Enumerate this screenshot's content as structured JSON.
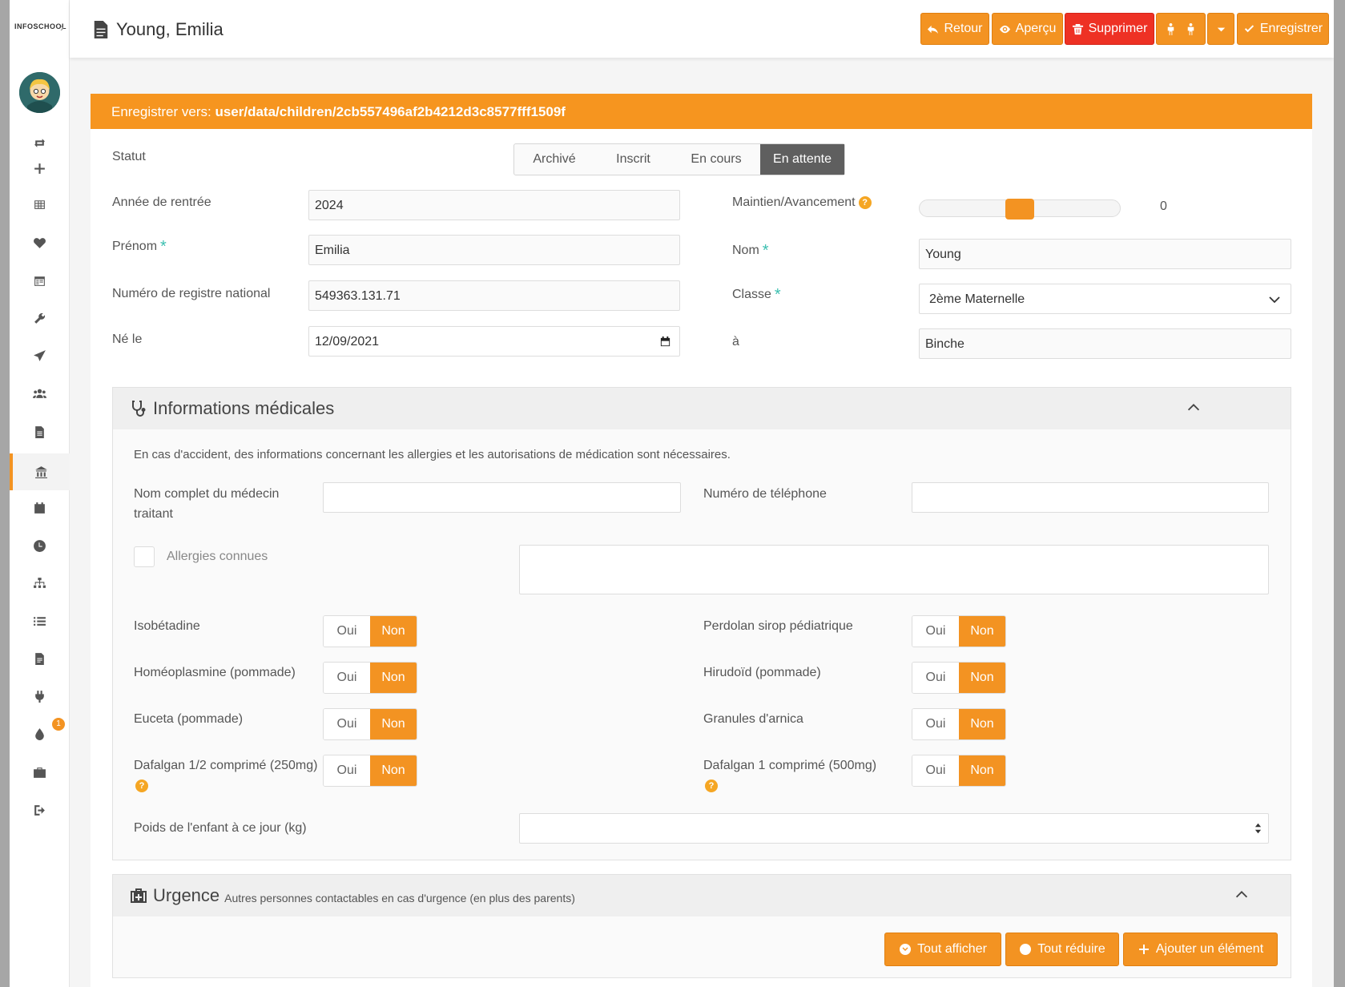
{
  "app": {
    "logo_text": "INFOSCHOOL"
  },
  "sidebar": {
    "badge_count": "1"
  },
  "header": {
    "title": "Young, Emilia",
    "buttons": {
      "back": "Retour",
      "preview": "Aperçu",
      "delete": "Supprimer",
      "save": "Enregistrer"
    }
  },
  "banner": {
    "prefix": "Enregistrer vers:",
    "path": "user/data/children/2cb557496af2b4212d3c8577fff1509f"
  },
  "form": {
    "status_label": "Statut",
    "status_options": [
      "Archivé",
      "Inscrit",
      "En cours",
      "En attente"
    ],
    "status_selected": "En attente",
    "entry_year_label": "Année de rentrée",
    "entry_year": "2024",
    "maintien_label": "Maintien/Avancement",
    "maintien_value": "0",
    "firstname_label": "Prénom",
    "firstname": "Emilia",
    "lastname_label": "Nom",
    "lastname": "Young",
    "national_id_label": "Numéro de registre national",
    "national_id": "549363.131.71",
    "class_label": "Classe",
    "class_value": "2ème Maternelle",
    "birth_label": "Né le",
    "birth_date": "12/09/2021",
    "birthplace_label": "à",
    "birthplace": "Binche"
  },
  "medical": {
    "title": "Informations médicales",
    "intro": "En cas d'accident, des informations concernant les allergies et les autorisations de médication sont nécessaires.",
    "doctor_label": "Nom complet du médecin traitant",
    "phone_label": "Numéro de téléphone",
    "allergies_label": "Allergies connues",
    "yes": "Oui",
    "no": "Non",
    "meds_left": [
      "Isobétadine",
      "Homéoplasmine (pommade)",
      "Euceta (pommade)",
      "Dafalgan 1/2 comprimé (250mg)"
    ],
    "meds_right": [
      "Perdolan sirop pédiatrique",
      "Hirudoïd (pommade)",
      "Granules d'arnica",
      "Dafalgan 1 comprimé (500mg)"
    ],
    "weight_label": "Poids de l'enfant à ce jour (kg)"
  },
  "urgence": {
    "title": "Urgence",
    "subtitle": "Autres personnes contactables en cas d'urgence (en plus des parents)",
    "show_all": "Tout afficher",
    "collapse_all": "Tout réduire",
    "add_item": "Ajouter un élément"
  },
  "colors": {
    "accent": "#f39322",
    "danger": "#ee3124",
    "teal": "#3bbfb0"
  }
}
